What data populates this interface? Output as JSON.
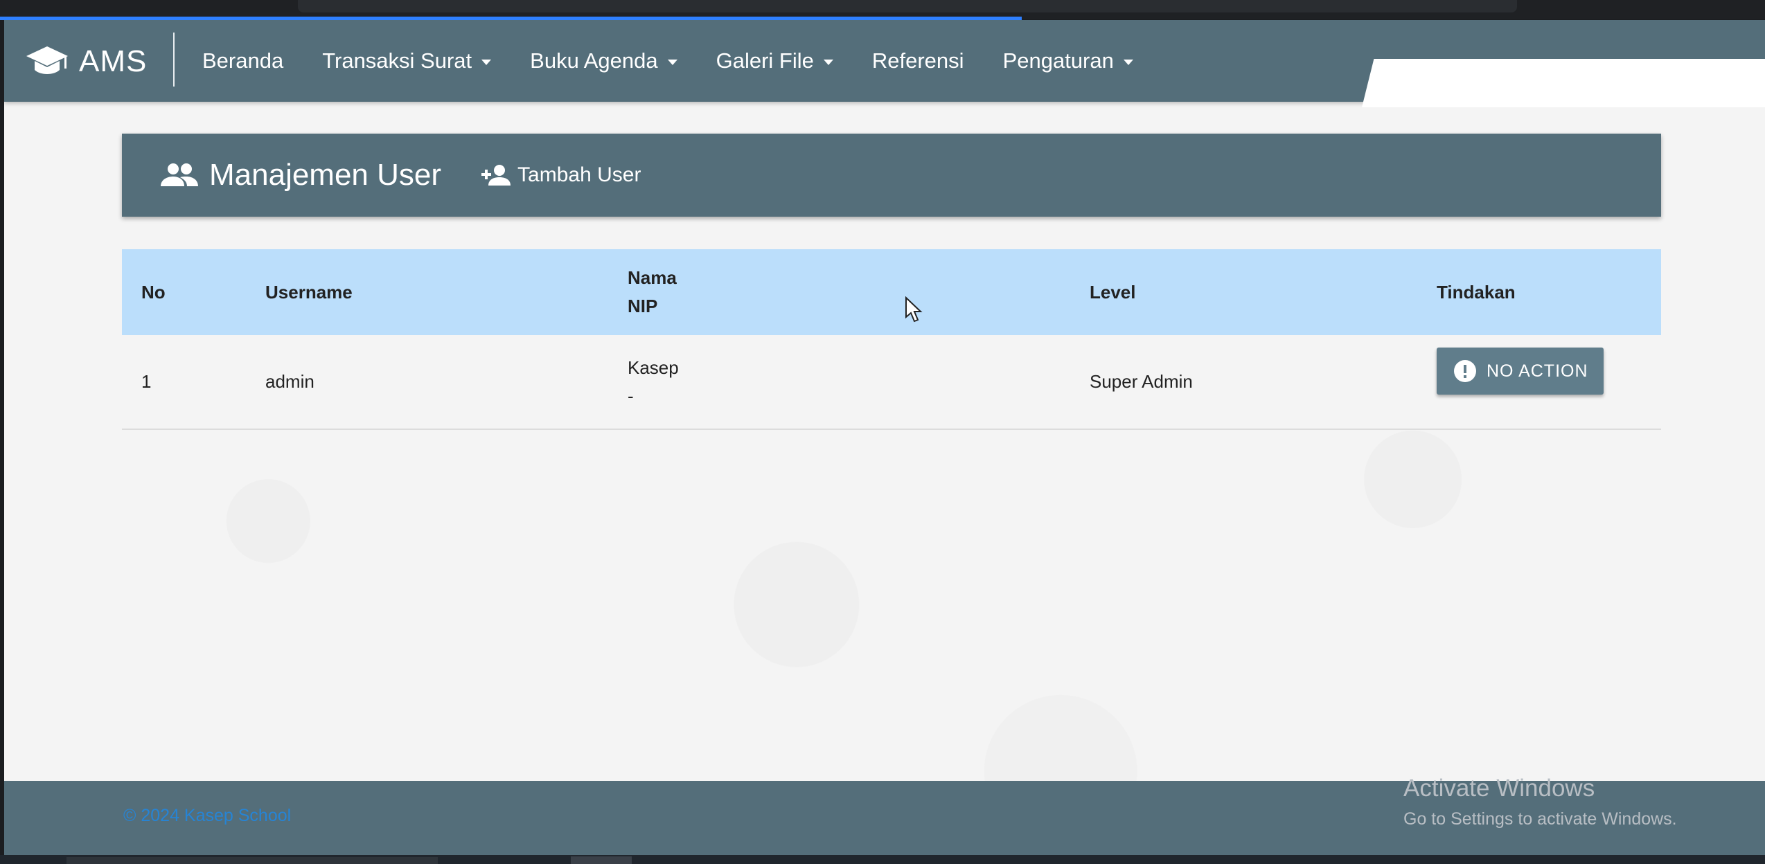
{
  "brand": {
    "name": "AMS",
    "logo_icon": "graduation-cap-icon"
  },
  "nav": {
    "items": [
      {
        "label": "Beranda",
        "dropdown": false
      },
      {
        "label": "Transaksi Surat",
        "dropdown": true
      },
      {
        "label": "Buku Agenda",
        "dropdown": true
      },
      {
        "label": "Galeri File",
        "dropdown": true
      },
      {
        "label": "Referensi",
        "dropdown": false
      },
      {
        "label": "Pengaturan",
        "dropdown": true
      }
    ]
  },
  "page": {
    "title": "Manajemen User",
    "title_icon": "people-icon",
    "add_user_label": "Tambah User",
    "add_user_icon": "person-add-icon"
  },
  "table": {
    "headers": {
      "no": "No",
      "username": "Username",
      "nama": "Nama",
      "nip": "NIP",
      "level": "Level",
      "tindakan": "Tindakan"
    },
    "rows": [
      {
        "no": "1",
        "username": "admin",
        "nama": "Kasep",
        "nip": "-",
        "level": "Super Admin",
        "action": "NO ACTION"
      }
    ]
  },
  "footer": {
    "copyright": "© 2024 Kasep School"
  },
  "watermark": {
    "line1": "Activate Windows",
    "line2": "Go to Settings to activate Windows."
  },
  "colors": {
    "primary": "#546e7a",
    "table_header": "#bbdefb",
    "button": "#607d8b",
    "footer_text": "#1e88e5"
  }
}
